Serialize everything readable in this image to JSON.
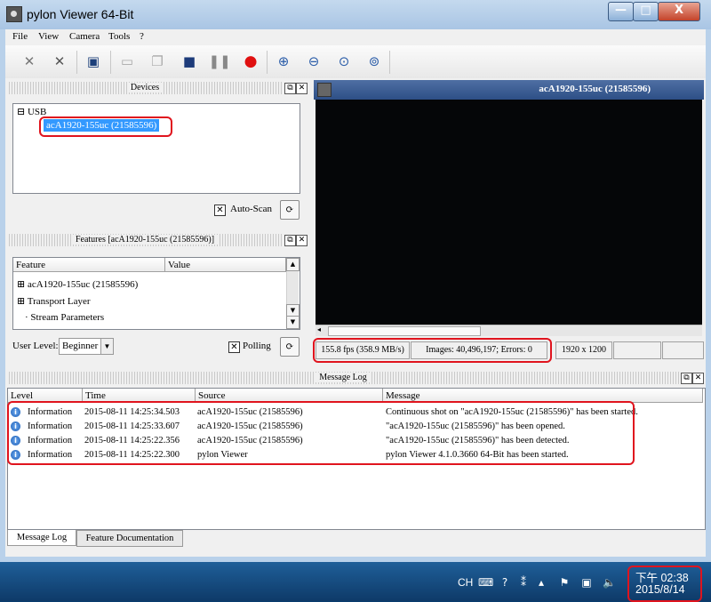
{
  "window": {
    "title": "pylon Viewer 64-Bit",
    "controls": {
      "minimize": "—",
      "maximize": "□",
      "close": "X"
    }
  },
  "menu": [
    "File",
    "View",
    "Camera",
    "Tools",
    "?"
  ],
  "toolbar_icons": [
    "open-camera-icon",
    "close-camera-icon",
    "save-icon",
    "single-shot-icon",
    "continuous-shot-icon",
    "stop-icon",
    "pause-icon",
    "record-icon",
    "zoom-in-icon",
    "zoom-out-icon",
    "fit-to-window-icon",
    "zoom-100-icon"
  ],
  "devices_panel": {
    "title": "Devices",
    "tree": {
      "root": "USB",
      "device": "acA1920-155uc (21585596)"
    },
    "auto_scan_label": "Auto-Scan",
    "auto_scan_checked": true
  },
  "features_panel": {
    "title": "Features [acA1920-155uc (21585596)]",
    "columns": [
      "Feature",
      "Value"
    ],
    "rows": [
      "acA1920-155uc (21585596)",
      "Transport Layer",
      "Stream Parameters"
    ],
    "user_level_label": "User Level:",
    "user_level_value": "Beginner",
    "polling_label": "Polling",
    "polling_checked": true
  },
  "image_panel": {
    "title": "acA1920-155uc (21585596)",
    "status": {
      "fps": "155.8 fps (358.9 MB/s)",
      "images": "Images: 40,496,197; Errors: 0",
      "resolution": "1920 x 1200"
    }
  },
  "message_log": {
    "title": "Message Log",
    "columns": [
      "Level",
      "Time",
      "Source",
      "Message"
    ],
    "rows": [
      {
        "level": "Information",
        "time": "2015-08-11 14:25:34.503",
        "source": "acA1920-155uc (21585596)",
        "message": "Continuous shot on \"acA1920-155uc (21585596)\" has been started."
      },
      {
        "level": "Information",
        "time": "2015-08-11 14:25:33.607",
        "source": "acA1920-155uc (21585596)",
        "message": "\"acA1920-155uc (21585596)\" has been opened."
      },
      {
        "level": "Information",
        "time": "2015-08-11 14:25:22.356",
        "source": "acA1920-155uc (21585596)",
        "message": "\"acA1920-155uc (21585596)\" has been detected."
      },
      {
        "level": "Information",
        "time": "2015-08-11 14:25:22.300",
        "source": "pylon Viewer",
        "message": "pylon Viewer 4.1.0.3660 64-Bit has been started."
      }
    ],
    "tabs": [
      "Message Log",
      "Feature Documentation"
    ]
  },
  "taskbar": {
    "language": "CH",
    "time": "下午 02:38",
    "date": "2015/8/14"
  },
  "colors": {
    "highlight": "#e0141e",
    "selection": "#3399ff",
    "taskbar": "#1f5f99"
  }
}
